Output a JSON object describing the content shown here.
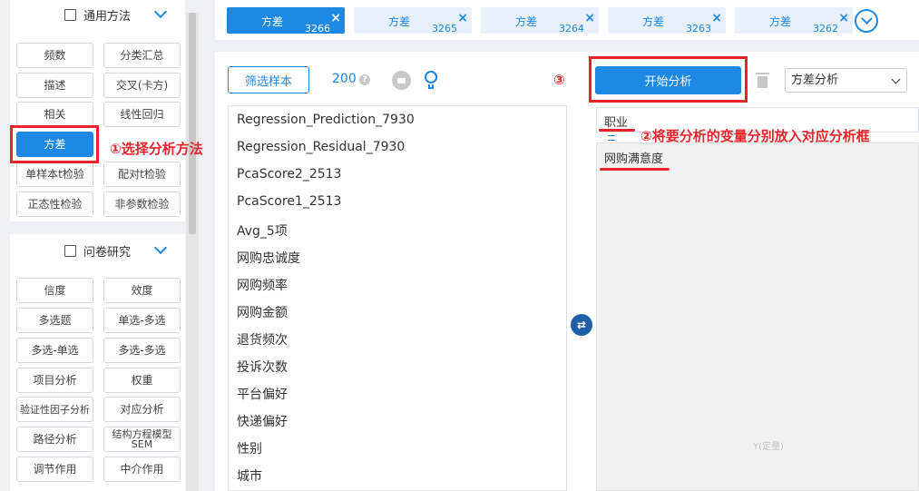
{
  "sidebar": {
    "section1": {
      "title": "通用方法",
      "buttons": [
        "频数",
        "分类汇总",
        "描述",
        "交叉(卡方)",
        "相关",
        "线性回归",
        "方差",
        "单样本t检验",
        "配对t检验",
        "正态性检验",
        "非参数检验"
      ]
    },
    "section2": {
      "title": "问卷研究",
      "buttons": [
        "信度",
        "效度",
        "多选题",
        "单选-多选",
        "多选-单选",
        "多选-多选",
        "项目分析",
        "权重",
        "验证性因子分析",
        "对应分析",
        "路径分析",
        "结构方程模型SEM",
        "调节作用",
        "中介作用"
      ]
    }
  },
  "tabs": [
    {
      "name": "方差",
      "number": "3266",
      "active": true
    },
    {
      "name": "方差",
      "number": "3265",
      "active": false
    },
    {
      "name": "方差",
      "number": "3264",
      "active": false
    },
    {
      "name": "方差",
      "number": "3263",
      "active": false
    },
    {
      "name": "方差",
      "number": "3262",
      "active": false
    }
  ],
  "toolbar": {
    "filter_label": "筛选样本",
    "sample_count": "200",
    "help_glyph": "?",
    "start_label": "开始分析",
    "method_selected": "方差分析"
  },
  "variables": [
    "Regression_Prediction_7930",
    "Regression_Residual_7930",
    "PcaScore2_2513",
    "PcaScore1_2513",
    "Avg_5项",
    "网购忠诚度",
    "网购频率",
    "网购金额",
    "退货频次",
    "投诉次数",
    "平台偏好",
    "快递偏好",
    "性别",
    "城市"
  ],
  "analysis": {
    "x_variable": "职业",
    "y_variable": "网购满意度",
    "y_hint": "Y(定量)",
    "swap_glyph": "⇄"
  },
  "annotations": {
    "step1": "①选择分析方法",
    "step2": "②将要分析的变量分别放入对应分析框",
    "step3": "③"
  },
  "colors": {
    "accent": "#1e88e5",
    "annotation": "#e8232a"
  }
}
